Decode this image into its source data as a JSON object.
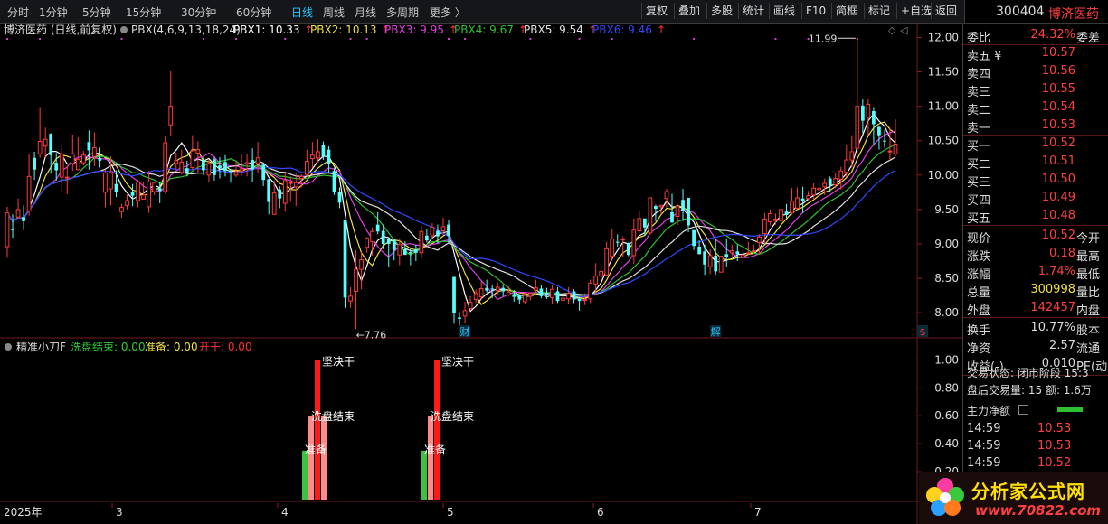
{
  "toolbar": {
    "periods": [
      "分时",
      "1分钟",
      "5分钟",
      "15分钟",
      "30分钟",
      "60分钟",
      "日线",
      "周线",
      "月线",
      "多周期",
      "更多 〉"
    ],
    "active_period": "日线",
    "tools": [
      "复权",
      "叠加",
      "多股",
      "统计",
      "画线",
      "F10",
      "简框",
      "标记",
      "+自选",
      "返回"
    ]
  },
  "stock": {
    "code": "300404",
    "name": "博济医药"
  },
  "chart_header": {
    "title": "博济医药 (日线,前复权)",
    "indicator": "PBX(4,6,9,13,18,24)",
    "items": [
      {
        "label": "PBX1: 10.33",
        "arrow": "↑",
        "color": "#ffffff"
      },
      {
        "label": "PBX2: 10.13",
        "arrow": "↑",
        "color": "#f0e040"
      },
      {
        "label": "PBX3: 9.95",
        "arrow": "↑",
        "color": "#e040e0"
      },
      {
        "label": "PBX4: 9.67",
        "arrow": "↑",
        "color": "#30c030"
      },
      {
        "label": "PBX5: 9.54",
        "arrow": "↑",
        "color": "#e0e0e0"
      },
      {
        "label": "PBX6: 9.46",
        "arrow": "↑",
        "color": "#3048ff"
      }
    ]
  },
  "chart_data": {
    "type": "candlestick",
    "y_axis_ticks": [
      12.0,
      11.5,
      11.0,
      10.5,
      10.0,
      9.5,
      9.0,
      8.5,
      8.0
    ],
    "ylim": [
      7.66,
      12.02
    ],
    "annotations": {
      "high": "11.99",
      "low": "←7.76"
    },
    "event_markers": [
      {
        "label": "财",
        "color": "#22c8ff"
      },
      {
        "label": "解",
        "color": "#22c8ff"
      },
      {
        "label": "$",
        "color": "#ff3030"
      }
    ],
    "x_labels": [
      "2025年",
      "3",
      "4",
      "5",
      "6",
      "7"
    ],
    "candles": [
      [
        8.96,
        9.45,
        9.54,
        8.8
      ],
      [
        9.22,
        9.2,
        9.43,
        9.09
      ],
      [
        9.39,
        9.5,
        9.66,
        9.37
      ],
      [
        9.39,
        9.33,
        9.56,
        9.2
      ],
      [
        9.48,
        9.98,
        10.3,
        9.41
      ],
      [
        10.25,
        10.08,
        10.34,
        9.93
      ],
      [
        10.31,
        10.49,
        10.99,
        10.25
      ],
      [
        10.42,
        10.52,
        10.69,
        10.26
      ],
      [
        10.6,
        10.29,
        10.61,
        10.02
      ],
      [
        10.18,
        10.07,
        10.32,
        9.92
      ],
      [
        9.97,
        10.31,
        10.43,
        9.74
      ],
      [
        9.96,
        9.97,
        10.13,
        9.72
      ],
      [
        10.17,
        10.31,
        10.59,
        10.06
      ],
      [
        10.08,
        10.23,
        10.55,
        10.07
      ],
      [
        10.18,
        10.29,
        10.35,
        10.14
      ],
      [
        10.48,
        10.36,
        10.65,
        10.08
      ],
      [
        10.27,
        10.4,
        10.62,
        10.13
      ],
      [
        10.25,
        10.21,
        10.4,
        10.11
      ],
      [
        9.75,
        10.03,
        10.08,
        9.53
      ],
      [
        9.8,
        10.05,
        10.27,
        9.56
      ],
      [
        9.87,
        9.76,
        10.07,
        9.68
      ],
      [
        9.47,
        9.53,
        9.58,
        9.38
      ],
      [
        9.56,
        9.63,
        9.72,
        9.5
      ],
      [
        9.75,
        9.7,
        9.87,
        9.55
      ],
      [
        9.63,
        9.9,
        9.93,
        9.53
      ],
      [
        9.65,
        9.71,
        9.9,
        9.65
      ],
      [
        9.54,
        9.9,
        10.06,
        9.45
      ],
      [
        9.76,
        9.89,
        9.9,
        9.71
      ],
      [
        9.81,
        9.77,
        9.9,
        9.59
      ],
      [
        9.76,
        10.47,
        10.57,
        9.73
      ],
      [
        10.73,
        11.0,
        11.51,
        10.56
      ],
      [
        10.17,
        10.21,
        10.33,
        10.08
      ],
      [
        10.04,
        10.19,
        10.37,
        10.01
      ],
      [
        10.1,
        10.03,
        10.21,
        9.98
      ],
      [
        10.11,
        10.35,
        10.58,
        10.08
      ],
      [
        10.32,
        10.37,
        10.49,
        10.02
      ],
      [
        10.22,
        10.07,
        10.26,
        10.0
      ],
      [
        10.0,
        10.17,
        10.22,
        9.89
      ],
      [
        10.23,
        10.0,
        10.26,
        9.92
      ],
      [
        10.14,
        10.1,
        10.26,
        9.95
      ],
      [
        10.19,
        10.06,
        10.29,
        9.98
      ],
      [
        10.06,
        10.05,
        10.09,
        9.89
      ],
      [
        10.0,
        10.05,
        10.2,
        9.97
      ],
      [
        10.06,
        10.09,
        10.31,
        9.99
      ],
      [
        10.16,
        10.18,
        10.3,
        9.98
      ],
      [
        10.22,
        10.08,
        10.39,
        9.9
      ],
      [
        10.17,
        10.25,
        10.48,
        10.02
      ],
      [
        10.15,
        9.93,
        10.16,
        9.84
      ],
      [
        9.94,
        9.61,
        9.95,
        9.43
      ],
      [
        9.43,
        9.74,
        9.92,
        9.43
      ],
      [
        9.79,
        9.66,
        9.84,
        9.52
      ],
      [
        9.59,
        9.92,
        10.03,
        9.47
      ],
      [
        9.88,
        9.89,
        9.98,
        9.61
      ],
      [
        9.83,
        9.89,
        10.02,
        9.55
      ],
      [
        9.95,
        9.98,
        10.01,
        9.82
      ],
      [
        10.01,
        10.2,
        10.37,
        9.98
      ],
      [
        10.24,
        10.29,
        10.48,
        10.1
      ],
      [
        10.25,
        10.34,
        10.52,
        10.18
      ],
      [
        10.44,
        10.27,
        10.49,
        10.22
      ],
      [
        10.37,
        10.17,
        10.42,
        10.02
      ],
      [
        10.06,
        9.75,
        10.1,
        9.71
      ],
      [
        9.76,
        9.6,
        9.82,
        9.52
      ],
      [
        9.34,
        8.22,
        9.34,
        8.07
      ],
      [
        8.17,
        8.24,
        8.37,
        8.07
      ],
      [
        8.31,
        8.63,
        8.91,
        7.76
      ],
      [
        8.63,
        8.77,
        8.88,
        8.34
      ],
      [
        8.95,
        9.08,
        9.1,
        8.87
      ],
      [
        9.03,
        9.18,
        9.24,
        8.83
      ],
      [
        9.28,
        9.18,
        9.46,
        9.14
      ],
      [
        9.19,
        9.0,
        9.28,
        8.92
      ],
      [
        9.07,
        9.0,
        9.09,
        8.66
      ],
      [
        9.06,
        8.91,
        9.06,
        8.76
      ],
      [
        8.84,
        8.99,
        9.08,
        8.69
      ],
      [
        8.92,
        8.84,
        9.04,
        8.85
      ],
      [
        8.88,
        8.86,
        8.93,
        8.69
      ],
      [
        8.92,
        8.87,
        8.99,
        8.75
      ],
      [
        8.87,
        9.18,
        9.26,
        8.79
      ],
      [
        9.12,
        9.05,
        9.21,
        9.02
      ],
      [
        9.12,
        9.24,
        9.3,
        9.07
      ],
      [
        9.19,
        9.11,
        9.28,
        9.01
      ],
      [
        9.19,
        9.25,
        9.38,
        9.13
      ],
      [
        9.28,
        9.12,
        9.35,
        9.01
      ],
      [
        8.52,
        7.99,
        8.52,
        7.84
      ],
      [
        7.93,
        7.91,
        8.01,
        7.82
      ],
      [
        7.95,
        8.03,
        8.16,
        7.84
      ],
      [
        8.06,
        8.15,
        8.24,
        8.03
      ],
      [
        8.19,
        8.28,
        8.34,
        8.14
      ],
      [
        8.23,
        8.35,
        8.45,
        8.19
      ],
      [
        8.36,
        8.32,
        8.48,
        8.29
      ],
      [
        8.35,
        8.34,
        8.41,
        8.21
      ],
      [
        8.32,
        8.37,
        8.44,
        8.25
      ],
      [
        8.36,
        8.31,
        8.41,
        8.24
      ],
      [
        8.26,
        8.3,
        8.38,
        8.24
      ],
      [
        8.27,
        8.23,
        8.33,
        8.16
      ],
      [
        8.26,
        8.19,
        8.27,
        8.13
      ],
      [
        8.16,
        8.25,
        8.29,
        8.12
      ],
      [
        8.24,
        8.28,
        8.29,
        8.18
      ],
      [
        8.33,
        8.36,
        8.48,
        8.27
      ],
      [
        8.35,
        8.24,
        8.4,
        8.21
      ],
      [
        8.29,
        8.25,
        8.36,
        8.2
      ],
      [
        8.22,
        8.34,
        8.4,
        8.12
      ],
      [
        8.31,
        8.17,
        8.37,
        8.14
      ],
      [
        8.18,
        8.21,
        8.29,
        8.13
      ],
      [
        8.2,
        8.28,
        8.37,
        8.12
      ],
      [
        8.31,
        8.19,
        8.34,
        8.14
      ],
      [
        8.2,
        8.17,
        8.23,
        8.03
      ],
      [
        8.19,
        8.19,
        8.28,
        8.11
      ],
      [
        8.2,
        8.43,
        8.48,
        8.14
      ],
      [
        8.42,
        8.53,
        8.72,
        8.25
      ],
      [
        8.53,
        8.6,
        8.69,
        8.46
      ],
      [
        8.55,
        8.93,
        9.03,
        8.54
      ],
      [
        8.82,
        9.07,
        9.21,
        8.77
      ],
      [
        9.03,
        9.02,
        9.14,
        8.96
      ],
      [
        9.07,
        9.07,
        9.11,
        8.81
      ],
      [
        9.01,
        8.84,
        9.02,
        8.82
      ],
      [
        8.83,
        9.2,
        9.37,
        8.71
      ],
      [
        9.19,
        9.37,
        9.49,
        9.16
      ],
      [
        9.37,
        9.24,
        9.37,
        9.12
      ],
      [
        9.16,
        9.67,
        9.67,
        9.14
      ],
      [
        9.55,
        9.51,
        9.57,
        9.33
      ],
      [
        9.54,
        9.56,
        9.57,
        9.43
      ],
      [
        9.66,
        9.76,
        9.8,
        9.53
      ],
      [
        9.46,
        9.31,
        9.73,
        9.33
      ],
      [
        9.4,
        9.55,
        9.55,
        9.27
      ],
      [
        9.64,
        9.48,
        9.8,
        9.33
      ],
      [
        9.67,
        9.27,
        9.67,
        9.17
      ],
      [
        9.2,
        8.97,
        9.2,
        8.91
      ],
      [
        8.96,
        8.85,
        9.05,
        8.85
      ],
      [
        8.89,
        8.7,
        8.99,
        8.55
      ],
      [
        8.67,
        8.83,
        8.92,
        8.56
      ],
      [
        8.83,
        8.6,
        9.08,
        8.55
      ],
      [
        8.59,
        8.82,
        8.83,
        8.61
      ],
      [
        8.85,
        8.81,
        9.08,
        8.66
      ],
      [
        8.87,
        8.9,
        8.99,
        8.82
      ],
      [
        8.89,
        8.85,
        8.99,
        8.75
      ],
      [
        8.81,
        8.84,
        8.94,
        8.72
      ],
      [
        8.86,
        8.87,
        9.03,
        8.86
      ],
      [
        8.9,
        8.9,
        8.99,
        8.88
      ],
      [
        9.02,
        9.1,
        9.14,
        8.85
      ],
      [
        9.15,
        9.36,
        9.45,
        9.0
      ],
      [
        9.32,
        9.44,
        9.5,
        9.27
      ],
      [
        9.34,
        9.36,
        9.44,
        9.28
      ],
      [
        9.34,
        9.5,
        9.62,
        9.29
      ],
      [
        9.47,
        9.42,
        9.58,
        9.37
      ],
      [
        9.45,
        9.62,
        9.81,
        9.42
      ],
      [
        9.52,
        9.67,
        9.82,
        9.51
      ],
      [
        9.66,
        9.63,
        9.83,
        9.45
      ],
      [
        9.66,
        9.7,
        9.77,
        9.63
      ],
      [
        9.71,
        9.81,
        9.88,
        9.64
      ],
      [
        9.79,
        9.81,
        9.9,
        9.65
      ],
      [
        9.83,
        9.88,
        9.95,
        9.71
      ],
      [
        9.95,
        9.85,
        9.98,
        9.76
      ],
      [
        9.86,
        9.95,
        10.04,
        9.81
      ],
      [
        9.94,
        10.06,
        10.12,
        9.79
      ],
      [
        10.04,
        10.22,
        10.44,
        9.97
      ],
      [
        10.22,
        10.34,
        10.58,
        10.11
      ],
      [
        10.39,
        11.0,
        11.99,
        10.32
      ],
      [
        11.01,
        10.79,
        11.1,
        10.61
      ],
      [
        10.84,
        11.03,
        11.1,
        10.59
      ],
      [
        10.93,
        10.74,
        10.99,
        10.44
      ],
      [
        10.7,
        10.58,
        10.72,
        10.37
      ],
      [
        10.5,
        10.49,
        10.65,
        10.4
      ],
      [
        10.35,
        10.35,
        10.69,
        10.22
      ],
      [
        10.31,
        10.45,
        10.81,
        10.27
      ]
    ]
  },
  "indicator_panel": {
    "title": "精准小刀F",
    "items": [
      {
        "label": "洗盘结束: 0.00",
        "color": "#30d030"
      },
      {
        "label": "准备: 0.00",
        "color": "#f0e040"
      },
      {
        "label": "开干: 0.00",
        "color": "#ff3030"
      }
    ],
    "y_axis_ticks": [
      1.0,
      0.8,
      0.6,
      0.4,
      0.2
    ],
    "ylim": [
      0,
      1.08
    ],
    "signal_labels": [
      "坚决干",
      "洗盘结束",
      "准备"
    ],
    "signals": [
      {
        "green": 0.35,
        "pink": 0.6,
        "red": 1.0,
        "pink2": 0.6
      },
      {
        "green": 0.35,
        "pink": 0.6,
        "red": 1.0,
        "pink2": 0
      }
    ]
  },
  "quote_panel": {
    "rows": [
      {
        "label": "委比",
        "value": "24.32%",
        "tail": "委差",
        "vcolor": "#ff4040"
      },
      {
        "label": "卖五 ¥",
        "value": "10.57",
        "tail": "",
        "vcolor": "#ff4040"
      },
      {
        "label": "卖四",
        "value": "10.56",
        "tail": "",
        "vcolor": "#ff4040"
      },
      {
        "label": "卖三",
        "value": "10.55",
        "tail": "",
        "vcolor": "#ff4040"
      },
      {
        "label": "卖二",
        "value": "10.54",
        "tail": "",
        "vcolor": "#ff4040"
      },
      {
        "label": "卖一",
        "value": "10.53",
        "tail": "",
        "vcolor": "#ff4040"
      },
      {
        "label": "买一",
        "value": "10.52",
        "tail": "",
        "vcolor": "#ff4040"
      },
      {
        "label": "买二",
        "value": "10.51",
        "tail": "",
        "vcolor": "#ff4040"
      },
      {
        "label": "买三",
        "value": "10.50",
        "tail": "",
        "vcolor": "#ff4040"
      },
      {
        "label": "买四",
        "value": "10.49",
        "tail": "",
        "vcolor": "#ff4040"
      },
      {
        "label": "买五",
        "value": "10.48",
        "tail": "",
        "vcolor": "#ff4040"
      },
      {
        "label": "现价",
        "value": "10.52",
        "tail": "今开",
        "vcolor": "#ff4040"
      },
      {
        "label": "涨跌",
        "value": "0.18",
        "tail": "最高",
        "vcolor": "#ff4040"
      },
      {
        "label": "涨幅",
        "value": "1.74%",
        "tail": "最低",
        "vcolor": "#ff4040"
      },
      {
        "label": "总量",
        "value": "300998",
        "tail": "量比",
        "vcolor": "#f0e040"
      },
      {
        "label": "外盘",
        "value": "142457",
        "tail": "内盘",
        "vcolor": "#ff4040"
      },
      {
        "label": "换手",
        "value": "10.77%",
        "tail": "股本",
        "vcolor": "#dcdcdc"
      },
      {
        "label": "净资",
        "value": "2.57",
        "tail": "流通",
        "vcolor": "#dcdcdc"
      },
      {
        "label": "收益(-)",
        "value": "0.010",
        "tail": "PE(动",
        "vcolor": "#dcdcdc"
      }
    ],
    "trade_status": "交易状态: 闭市阶段  15:3",
    "after_hours": "盘后交易量: 15   额: 1.6万",
    "main_flow": "主力净额",
    "trades": [
      {
        "time": "14:59",
        "price": "10.53"
      },
      {
        "time": "14:59",
        "price": "10.53"
      },
      {
        "time": "14:59",
        "price": "10.52"
      }
    ]
  },
  "watermark": {
    "name": "分析家公式网",
    "url": "www.70822.com"
  }
}
